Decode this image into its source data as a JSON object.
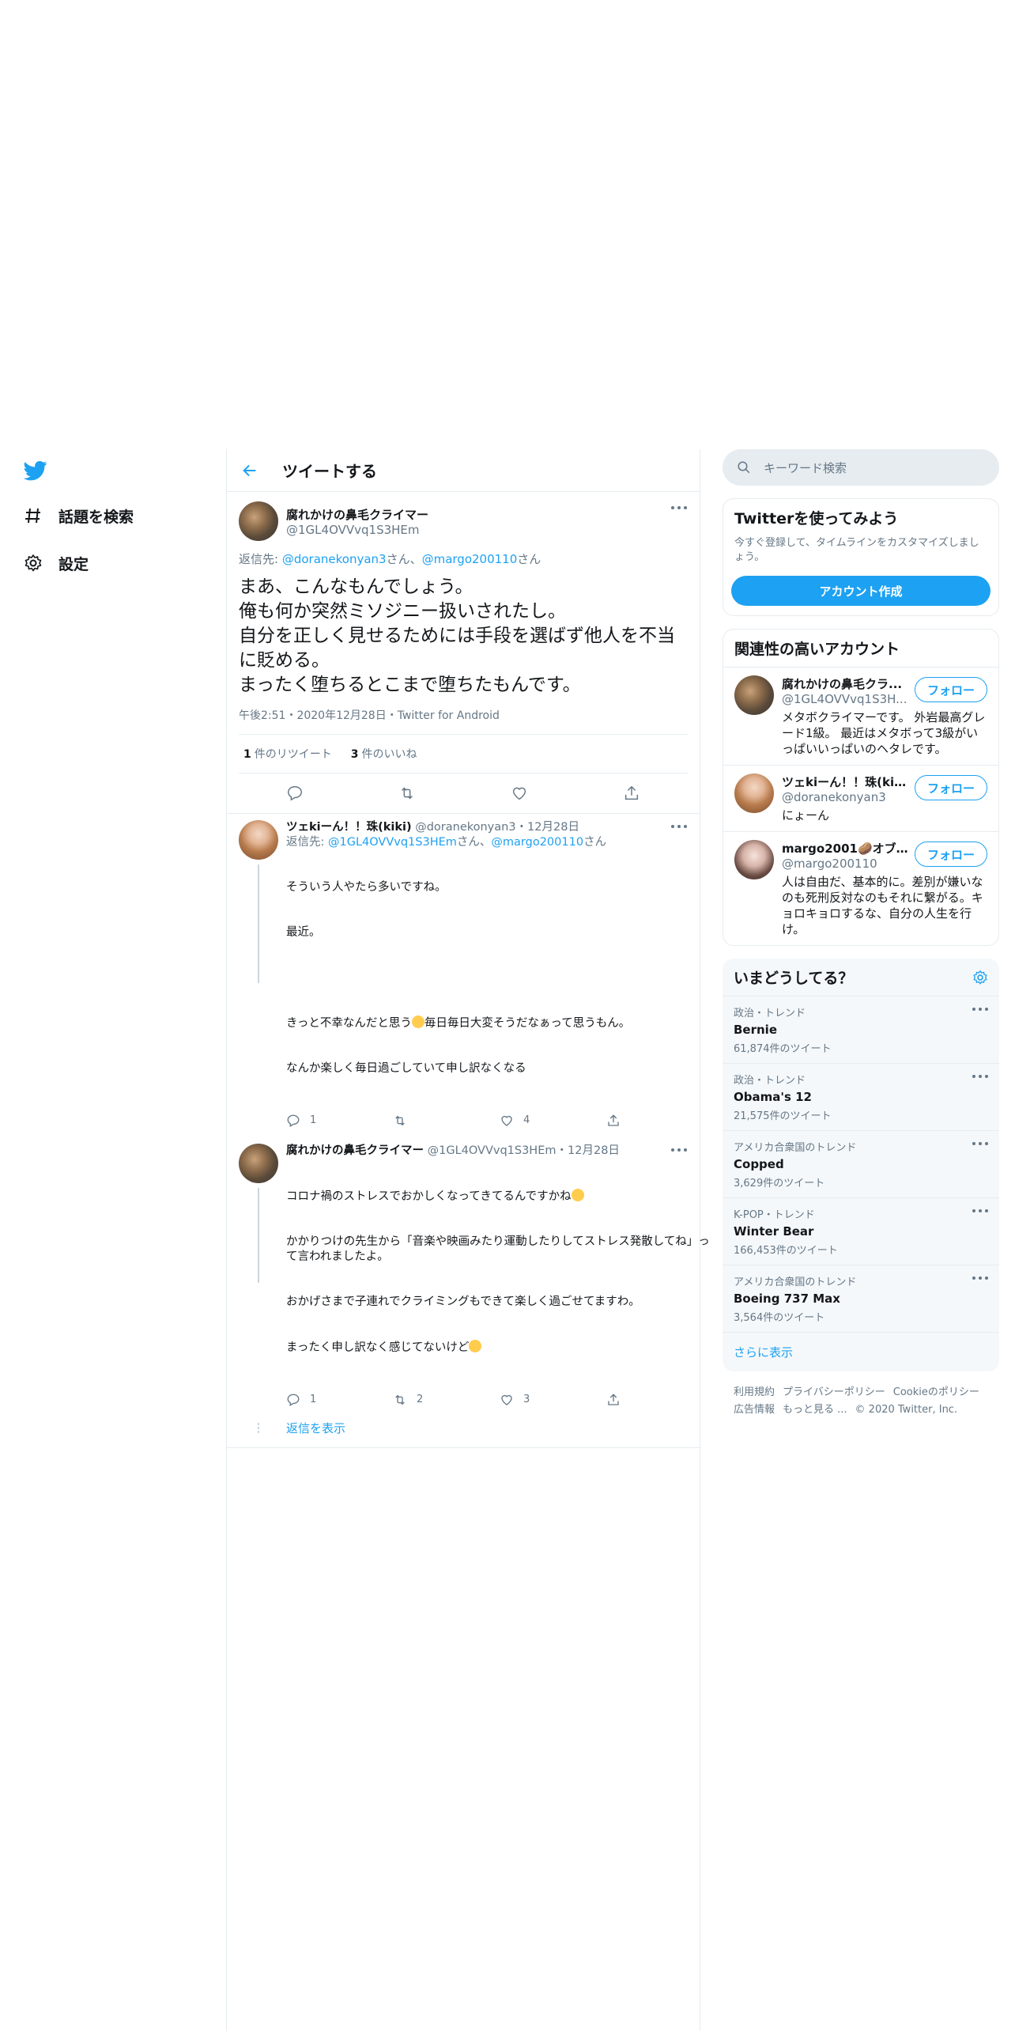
{
  "nav": {
    "explore_label": "話題を検索",
    "settings_label": "設定"
  },
  "header": {
    "title": "ツイートする"
  },
  "tweet": {
    "display_name": "腐れかけの鼻毛クライマー",
    "username": "@1GL4OVVvq1S3HEm",
    "reply_prefix": "返信先: ",
    "reply_user1": "@doranekonyan3",
    "reply_san1": "さん、",
    "reply_user2": "@margo200110",
    "reply_san2": "さん",
    "text": "まあ、こんなもんでしょう。\n俺も何か突然ミソジニー扱いされたし。\n自分を正しく見せるためには手段を選ばず他人を不当に貶める。\nまったく堕ちるとこまで堕ちたもんです。",
    "meta": "午後2:51・2020年12月28日・Twitter for Android",
    "retweets_count": "1",
    "retweets_label": "件のリツイート",
    "likes_count": "3",
    "likes_label": "件のいいね"
  },
  "replies": [
    {
      "display_name": "ツェkiーん！！珠(kiki)",
      "username": "@doranekonyan3",
      "date": "・12月28日",
      "reply_prefix": "返信先: ",
      "reply_user1": "@1GL4OVVvq1S3HEm",
      "reply_san1": "さん、",
      "reply_user2": "@margo200110",
      "reply_san2": "さん",
      "line1": "そういう人やたら多いですね。",
      "line2": "最近。",
      "line3a": "きっと不幸なんだと思う",
      "line3b": "毎日毎日大変そうだなぁって思うもん。",
      "line4": "なんか楽しく毎日過ごしていて申し訳なくなる",
      "reply_count": "1",
      "retweet_count": "",
      "like_count": "4"
    },
    {
      "display_name": "腐れかけの鼻毛クライマー",
      "username": "@1GL4OVVvq1S3HEm",
      "date": "・12月28日",
      "line1": "コロナ禍のストレスでおかしくなってきてるんですかね",
      "line2": "かかりつけの先生から「音楽や映画みたり運動したりしてストレス発散してね」って言われましたよ。",
      "line3": "おかげさまで子連れでクライミングもできて楽しく過ごせてますわ。",
      "line4": "まったく申し訳なく感じてないけど",
      "reply_count": "1",
      "retweet_count": "2",
      "like_count": "3"
    }
  ],
  "show_replies": "返信を表示",
  "search": {
    "placeholder": "キーワード検索"
  },
  "signup": {
    "title": "Twitterを使ってみよう",
    "desc": "今すぐ登録して、タイムラインをカスタマイズしましょう。",
    "button": "アカウント作成"
  },
  "related": {
    "title": "関連性の高いアカウント",
    "follow_label": "フォロー",
    "accounts": [
      {
        "display_name": "腐れかけの鼻毛クラ...",
        "username": "@1GL4OVVvq1S3H...",
        "bio": "メタボクライマーです。 外岩最高グレード1級。 最近はメタボって3級がいっぱいいっぱいのヘタレです。"
      },
      {
        "display_name": "ツェkiーん！！珠(kiki)",
        "username": "@doranekonyan3",
        "bio": "にょーん"
      },
      {
        "display_name": "margo2001🥔オブ・...",
        "username": "@margo200110",
        "bio": "人は自由だ、基本的に。差別が嫌いなのも死刑反対なのもそれに繋がる。キョロキョロするな、自分の人生を行け。"
      }
    ]
  },
  "trends": {
    "title": "いまどうしてる？",
    "items": [
      {
        "context": "政治・トレンド",
        "name": "Bernie",
        "count": "61,874件のツイート"
      },
      {
        "context": "政治・トレンド",
        "name": "Obama's 12",
        "count": "21,575件のツイート"
      },
      {
        "context": "アメリカ合衆国のトレンド",
        "name": "Copped",
        "count": "3,629件のツイート"
      },
      {
        "context": "K-POP・トレンド",
        "name": "Winter Bear",
        "count": "166,453件のツイート"
      },
      {
        "context": "アメリカ合衆国のトレンド",
        "name": "Boeing 737 Max",
        "count": "3,564件のツイート"
      }
    ],
    "show_more": "さらに表示"
  },
  "footer": {
    "links": [
      "利用規約",
      "プライバシーポリシー",
      "Cookieのポリシー",
      "広告情報",
      "もっと見る ..."
    ],
    "copyright": "© 2020 Twitter, Inc."
  },
  "colors": {
    "accent": "#1da1f2",
    "secondary_text": "#657786",
    "border": "#e6ecf0"
  }
}
